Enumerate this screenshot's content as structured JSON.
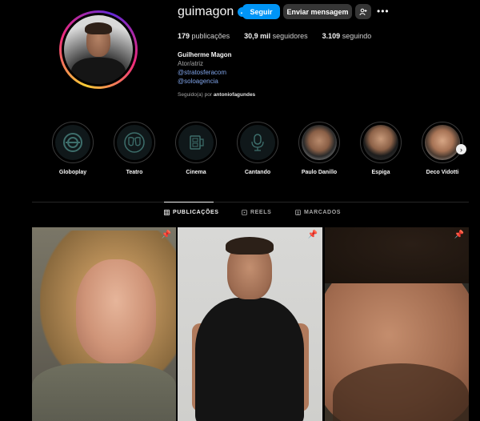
{
  "profile": {
    "username": "guimagon",
    "follow_label": "Seguir",
    "message_label": "Enviar mensagem",
    "more_label": "•••",
    "stats": {
      "posts_value": "179",
      "posts_label": "publicações",
      "followers_value": "30,9 mil",
      "followers_label": "seguidores",
      "following_value": "3.109",
      "following_label": "seguindo"
    },
    "bio": {
      "name": "Guilherme Magon",
      "category": "Ator/atriz",
      "link1": "@stratosferacom",
      "link2": "@soloagencia"
    },
    "followed_by_prefix": "Seguido(a) por",
    "followed_by_user": "antoniofagundes"
  },
  "highlights": [
    {
      "label": "Globoplay",
      "icon": "globoplay-icon"
    },
    {
      "label": "Teatro",
      "icon": "theater-masks-icon"
    },
    {
      "label": "Cinema",
      "icon": "film-reel-icon"
    },
    {
      "label": "Cantando",
      "icon": "microphone-icon"
    },
    {
      "label": "Paulo Danillo",
      "icon": "photo"
    },
    {
      "label": "Espiga",
      "icon": "photo"
    },
    {
      "label": "Deco Vidotti",
      "icon": "photo"
    }
  ],
  "tabs": [
    {
      "label": "PUBLICAÇÕES",
      "icon": "grid-icon",
      "active": true
    },
    {
      "label": "REELS",
      "icon": "reels-icon",
      "active": false
    },
    {
      "label": "MARCADOS",
      "icon": "tagged-icon",
      "active": false
    }
  ],
  "colors": {
    "accent": "#0095f6",
    "background": "#000000",
    "secondary_button": "#363636",
    "link": "#7fa3e8"
  }
}
